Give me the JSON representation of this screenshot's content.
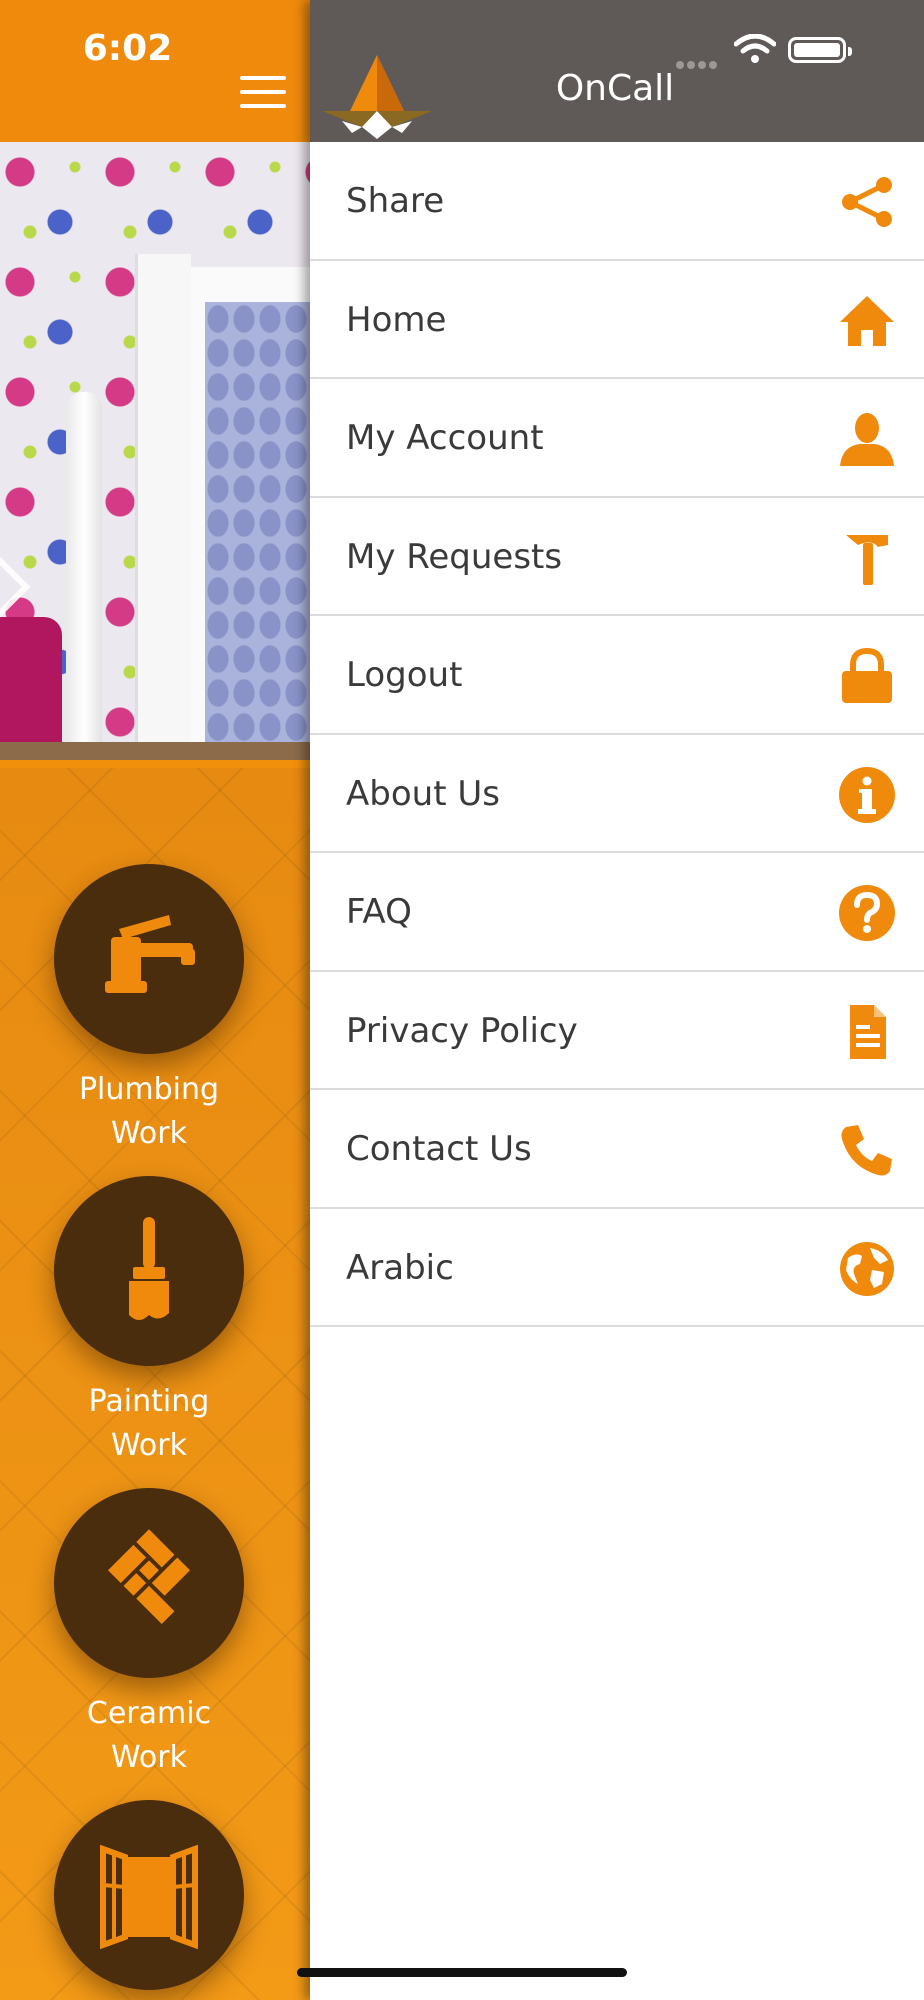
{
  "status_bar": {
    "time": "6:02"
  },
  "drawer": {
    "title": "OnCall",
    "items": [
      {
        "label": "Share",
        "icon": "share-icon"
      },
      {
        "label": "Home",
        "icon": "home-icon"
      },
      {
        "label": "My Account",
        "icon": "user-icon"
      },
      {
        "label": "My Requests",
        "icon": "hammer-icon"
      },
      {
        "label": "Logout",
        "icon": "lock-icon"
      },
      {
        "label": "About Us",
        "icon": "info-icon"
      },
      {
        "label": "FAQ",
        "icon": "question-icon"
      },
      {
        "label": "Privacy Policy",
        "icon": "document-icon"
      },
      {
        "label": "Contact Us",
        "icon": "phone-icon"
      },
      {
        "label": "Arabic",
        "icon": "globe-icon"
      }
    ]
  },
  "services": [
    {
      "label": "Plumbing\nWork",
      "icon": "faucet-icon"
    },
    {
      "label": "Painting\nWork",
      "icon": "paintbrush-icon"
    },
    {
      "label": "Ceramic\nWork",
      "icon": "tiles-icon"
    },
    {
      "label": "",
      "icon": "window-icon"
    }
  ],
  "colors": {
    "accent": "#EF8A0C",
    "header_gray": "#5F5A58",
    "service_circle": "#4A2D0D",
    "menu_text": "#3A3A3A"
  }
}
